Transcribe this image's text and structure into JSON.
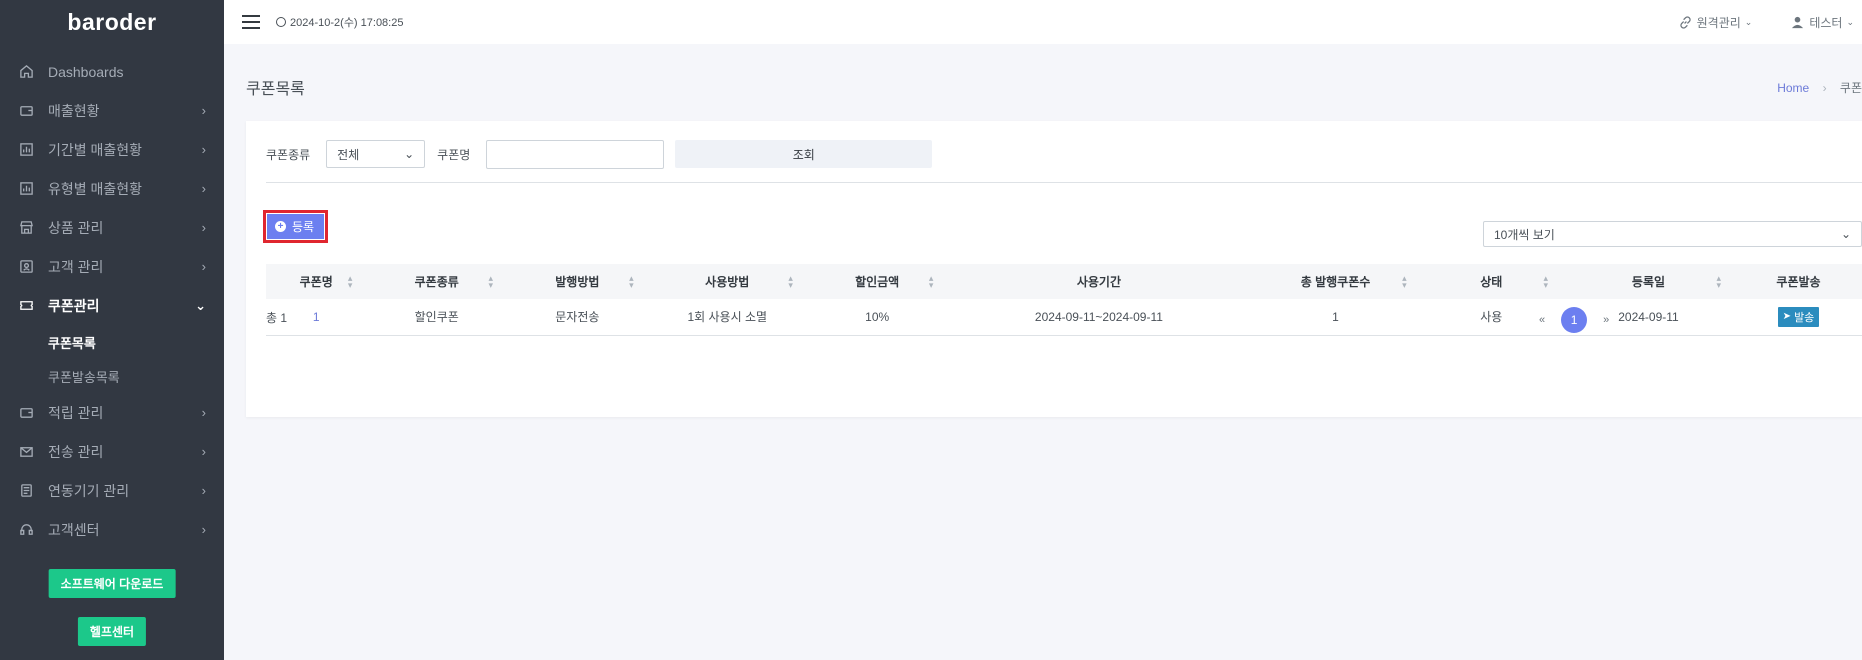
{
  "sidebar": {
    "logo": "baroder",
    "items": [
      {
        "label": "Dashboards",
        "chevron": ""
      },
      {
        "label": "매출현황",
        "chevron": "›"
      },
      {
        "label": "기간별 매출현황",
        "chevron": "›"
      },
      {
        "label": "유형별 매출현황",
        "chevron": "›"
      },
      {
        "label": "상품 관리",
        "chevron": "›"
      },
      {
        "label": "고객 관리",
        "chevron": "›"
      },
      {
        "label": "쿠폰관리",
        "chevron": "⌄"
      },
      {
        "label": "적립 관리",
        "chevron": "›"
      },
      {
        "label": "전송 관리",
        "chevron": "›"
      },
      {
        "label": "연동기기 관리",
        "chevron": "›"
      },
      {
        "label": "고객센터",
        "chevron": "›"
      }
    ],
    "subitems": [
      "쿠폰목록",
      "쿠폰발송목록"
    ],
    "download_button": "소프트웨어 다운로드",
    "help_button": "헬프센터"
  },
  "topbar": {
    "datetime": "2024-10-2(수) 17:08:25",
    "remote": "원격관리",
    "user": "테스터"
  },
  "page": {
    "title": "쿠폰목록",
    "breadcrumb_home": "Home",
    "breadcrumb_sep": "›",
    "breadcrumb_current": "쿠폰"
  },
  "filter": {
    "type_label": "쿠폰종류",
    "type_value": "전체",
    "name_label": "쿠폰명",
    "name_value": "",
    "search_button": "조회"
  },
  "actions": {
    "register_button": "등록",
    "page_size": "10개씩 보기"
  },
  "table": {
    "columns": [
      "쿠폰명",
      "쿠폰종류",
      "발행방법",
      "사용방법",
      "할인금액",
      "사용기간",
      "총 발행쿠폰수",
      "상태",
      "등록일",
      "쿠폰발송"
    ],
    "rows": [
      {
        "name": "1",
        "type": "할인쿠폰",
        "issue": "문자전송",
        "usage": "1회 사용시 소멸",
        "discount": "10%",
        "period": "2024-09-11~2024-09-11",
        "count": "1",
        "status": "사용",
        "date": "2024-09-11",
        "send": "발송"
      }
    ]
  },
  "footer": {
    "total": "총 1",
    "prev": "«",
    "page": "1",
    "next": "»"
  },
  "colors": {
    "sidebar_bg": "#323842",
    "accent": "#6c7ff0",
    "green": "#1cc88a",
    "send": "#2b8cbe",
    "highlight": "#e0262f"
  }
}
